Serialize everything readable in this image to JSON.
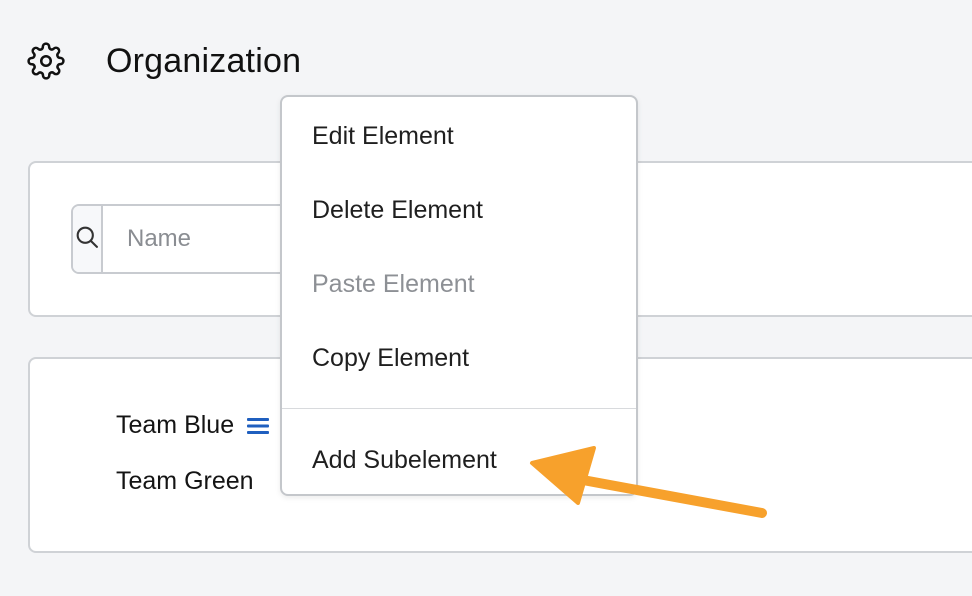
{
  "header": {
    "icon": "gear-icon",
    "title": "Organization"
  },
  "search": {
    "icon": "search-icon",
    "placeholder": "Name",
    "value": ""
  },
  "tree": {
    "items": [
      {
        "label": "Team Blue",
        "has_menu_icon": true,
        "menu_icon": "hamburger-icon",
        "menu_icon_color": "#1f5fbf"
      },
      {
        "label": "Team Green",
        "has_menu_icon": false
      }
    ]
  },
  "context_menu": {
    "items": [
      {
        "label": "Edit Element",
        "disabled": false
      },
      {
        "label": "Delete Element",
        "disabled": false
      },
      {
        "label": "Paste Element",
        "disabled": true
      },
      {
        "label": "Copy Element",
        "disabled": false
      },
      {
        "label": "Add Subelement",
        "disabled": false
      }
    ]
  },
  "annotation": {
    "type": "arrow",
    "color": "#f7a12c",
    "points_to": "Add Subelement"
  }
}
